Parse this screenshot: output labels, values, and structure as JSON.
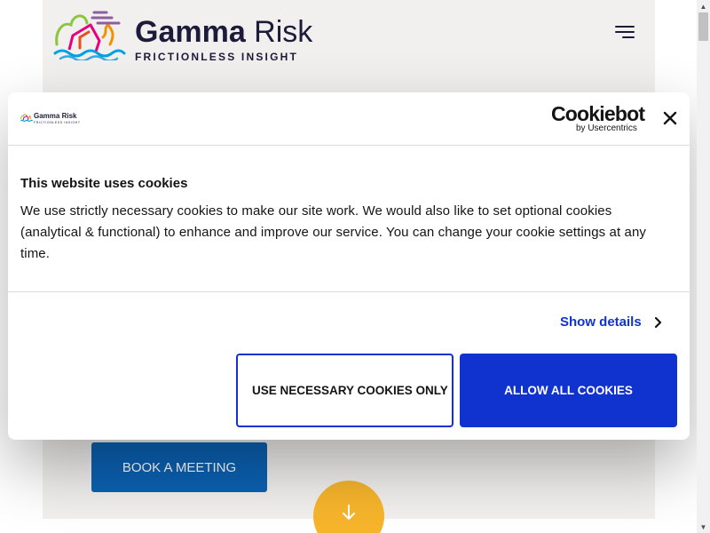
{
  "header": {
    "logo_name_bold": "Gamma",
    "logo_name_light": " Risk",
    "logo_tagline": "FRICTIONLESS INSIGHT",
    "menu_icon": "hamburger-menu-icon"
  },
  "hero": {
    "cta_label": "BOOK A MEETING",
    "scroll_icon": "arrow-down-icon"
  },
  "cookie_dialog": {
    "logo_name": "Gamma Risk",
    "logo_tagline": "FRICTIONLESS INSIGHT",
    "provider_name": "Cookiebot",
    "provider_sub": "by Usercentrics",
    "close_icon": "close-icon",
    "title": "This website uses cookies",
    "body": "We use strictly necessary cookies to make our site work. We would also like to set optional cookies (analytical & functional) to enhance and improve our service. You can change your cookie settings at any time.",
    "show_details_label": "Show details",
    "necessary_button": "USE NECESSARY COOKIES ONLY",
    "allow_button": "ALLOW ALL COOKIES"
  },
  "colors": {
    "brand_navy": "#1c1b3a",
    "cookiebot_blue": "#1032cf",
    "cta_blue": "#0b62b3",
    "accent_yellow": "#f7b52c",
    "page_panel": "#f2f0ee"
  }
}
